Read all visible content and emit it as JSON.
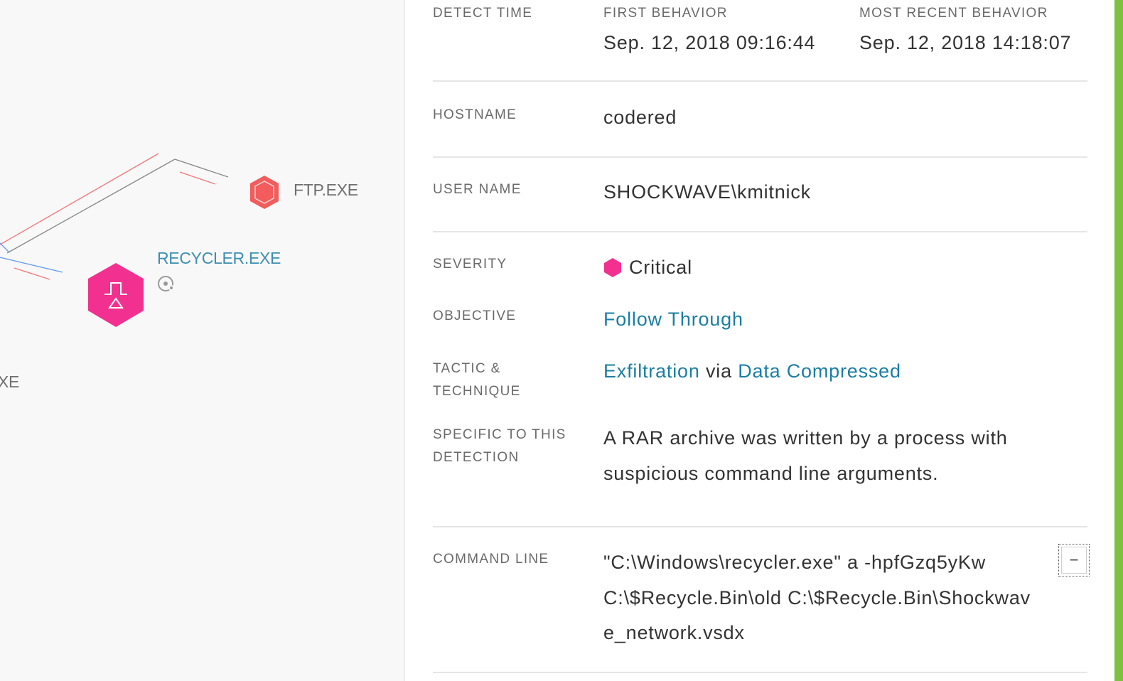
{
  "graph": {
    "nodes": [
      {
        "label": "FTP.EXE",
        "icon": "hexagon-icon",
        "color": "#f25c5c"
      },
      {
        "label": "RECYCLER.EXE",
        "icon": "process-icon",
        "color": "#f2308f",
        "label_color": "#3d8fb0"
      },
      {
        "label": "XE"
      }
    ]
  },
  "details": {
    "detect_time": {
      "label": "DETECT TIME"
    },
    "first_behavior": {
      "label": "FIRST BEHAVIOR",
      "value": "Sep. 12, 2018 09:16:44"
    },
    "most_recent_behavior": {
      "label": "MOST RECENT BEHAVIOR",
      "value": "Sep. 12, 2018 14:18:07"
    },
    "hostname": {
      "label": "HOSTNAME",
      "value": "codered"
    },
    "user_name": {
      "label": "USER NAME",
      "value": "SHOCKWAVE\\kmitnick"
    },
    "severity": {
      "label": "SEVERITY",
      "value": "Critical",
      "color": "#f2308f"
    },
    "objective": {
      "label": "OBJECTIVE",
      "value": "Follow Through"
    },
    "tactic": {
      "label_line1": "TACTIC &",
      "label_line2": "TECHNIQUE",
      "tactic": "Exfiltration",
      "via": "via",
      "technique": "Data Compressed"
    },
    "specific": {
      "label_line1": "SPECIFIC TO THIS",
      "label_line2": "DETECTION",
      "line1": "A RAR archive was written by a process with",
      "line2": "suspicious command line arguments."
    },
    "command_line": {
      "label": "COMMAND LINE",
      "line1": "\"C:\\Windows\\recycler.exe\" a -hpfGzq5yKw",
      "line2": "C:\\$Recycle.Bin\\old C:\\$Recycle.Bin\\Shockwav",
      "line3": "e_network.vsdx",
      "collapse_label": "−"
    },
    "accent_color": "#7ec13f"
  }
}
